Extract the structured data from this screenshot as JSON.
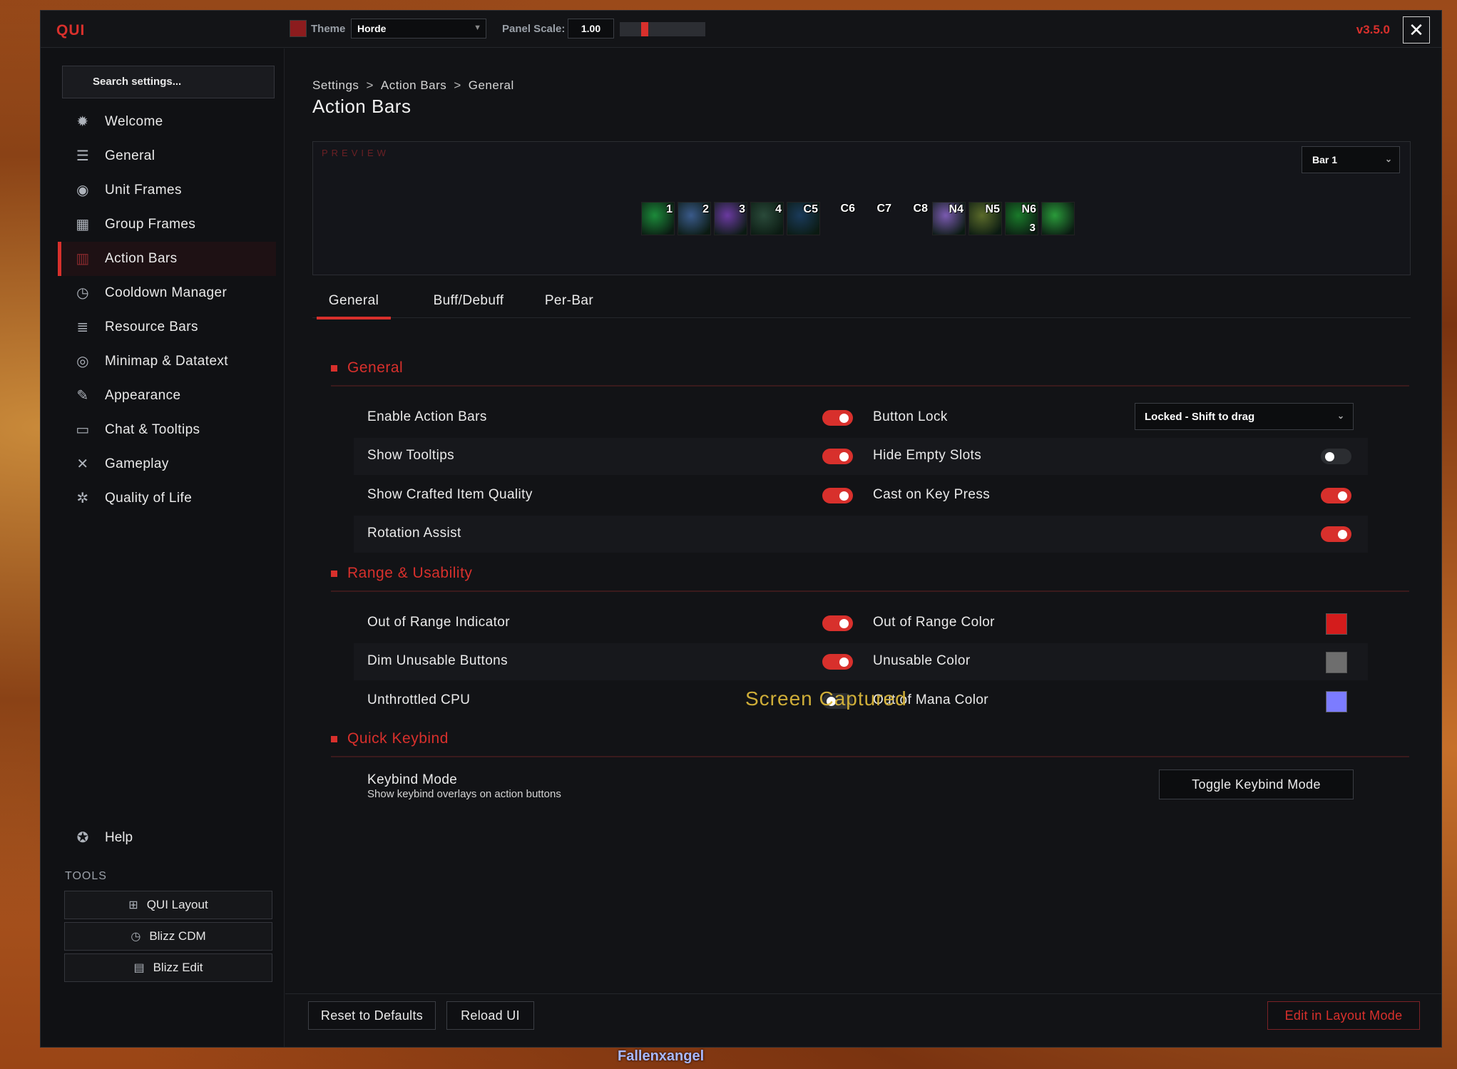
{
  "app": {
    "logo": "QUI",
    "version": "v3.5.0",
    "close_label": "✕"
  },
  "topbar": {
    "theme_label": "Theme",
    "theme_value": "Horde",
    "theme_swatch": "#8c1c1e",
    "scale_label": "Panel Scale:",
    "scale_value": "1.00"
  },
  "sidebar": {
    "search_placeholder": "Search settings...",
    "items": [
      {
        "label": "Welcome",
        "icon": "compass-icon"
      },
      {
        "label": "General",
        "icon": "sliders-icon"
      },
      {
        "label": "Unit Frames",
        "icon": "portrait-icon"
      },
      {
        "label": "Group Frames",
        "icon": "group-icon"
      },
      {
        "label": "Action Bars",
        "icon": "action-bars-icon",
        "active": true
      },
      {
        "label": "Cooldown Manager",
        "icon": "clock-icon"
      },
      {
        "label": "Resource Bars",
        "icon": "list-icon"
      },
      {
        "label": "Minimap & Datatext",
        "icon": "minimap-icon"
      },
      {
        "label": "Appearance",
        "icon": "brush-icon"
      },
      {
        "label": "Chat & Tooltips",
        "icon": "chat-icon"
      },
      {
        "label": "Gameplay",
        "icon": "swords-icon"
      },
      {
        "label": "Quality of Life",
        "icon": "gear-icon"
      }
    ],
    "help_label": "Help",
    "tools_label": "TOOLS",
    "tools": [
      {
        "label": "QUI Layout",
        "icon": "layout-icon"
      },
      {
        "label": "Blizz CDM",
        "icon": "cdm-icon"
      },
      {
        "label": "Blizz Edit",
        "icon": "edit-icon"
      }
    ]
  },
  "breadcrumb": [
    "Settings",
    "Action Bars",
    "General"
  ],
  "breadcrumb_sep": ">",
  "page_title": "Action Bars",
  "preview": {
    "label": "PREVIEW",
    "bar_select": "Bar 1",
    "slots": [
      {
        "key": "1",
        "count": "",
        "color": "#1c8a3a"
      },
      {
        "key": "2",
        "count": "",
        "color": "#3a5a8a"
      },
      {
        "key": "3",
        "count": "",
        "color": "#6a3aa0"
      },
      {
        "key": "4",
        "count": "",
        "color": "#2a4a3a"
      },
      {
        "key": "C5",
        "count": "",
        "color": "#1a3a5a"
      },
      {
        "key": "C6",
        "count": "",
        "color": ""
      },
      {
        "key": "C7",
        "count": "",
        "color": ""
      },
      {
        "key": "C8",
        "count": "",
        "color": ""
      },
      {
        "key": "N4",
        "count": "",
        "color": "#7a5ab0"
      },
      {
        "key": "N5",
        "count": "",
        "color": "#5a6a2a"
      },
      {
        "key": "N6",
        "count": "3",
        "color": "#1a7a2a"
      },
      {
        "key": "",
        "count": "",
        "color": "#2a9a3a"
      }
    ]
  },
  "tabs": [
    "General",
    "Buff/Debuff",
    "Per-Bar"
  ],
  "sections": {
    "general": {
      "title": "General",
      "rows": [
        {
          "left": "Enable Action Bars",
          "left_on": true,
          "right": "Button Lock",
          "right_select": "Locked - Shift to drag"
        },
        {
          "left": "Show Tooltips",
          "left_on": true,
          "right": "Hide Empty Slots",
          "right_on": false
        },
        {
          "left": "Show Crafted Item Quality",
          "left_on": true,
          "right": "Cast on Key Press",
          "right_on": true
        },
        {
          "left": "Rotation Assist",
          "right_on": true
        }
      ]
    },
    "range": {
      "title": "Range & Usability",
      "rows": [
        {
          "left": "Out of Range Indicator",
          "left_on": true,
          "right": "Out of Range Color",
          "color": "#d41c1c"
        },
        {
          "left": "Dim Unusable Buttons",
          "left_on": true,
          "right": "Unusable Color",
          "color": "#6e6e6e"
        },
        {
          "left": "Unthrottled CPU",
          "left_on": false,
          "right": "Out of Mana Color",
          "color": "#7c7cff"
        }
      ]
    },
    "keybind": {
      "title": "Quick Keybind",
      "row_label": "Keybind Mode",
      "row_desc": "Show keybind overlays on action buttons",
      "button": "Toggle Keybind Mode"
    }
  },
  "overlay_text": "Screen Captured",
  "footer": {
    "reset": "Reset to Defaults",
    "reload": "Reload UI",
    "layout": "Edit in Layout Mode"
  },
  "game_name": "Fallenxangel"
}
